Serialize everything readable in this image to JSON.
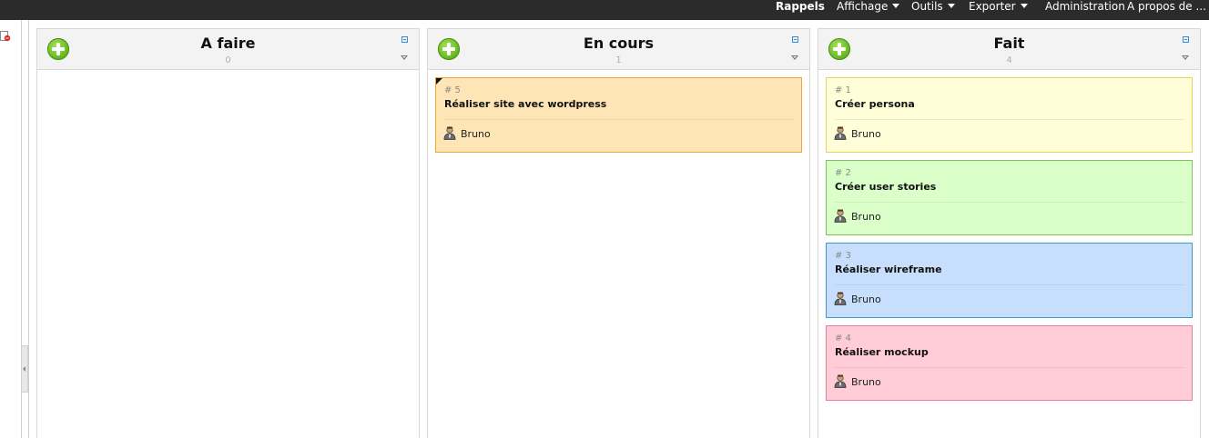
{
  "topbar": {
    "items": [
      {
        "label": "Rappels"
      },
      {
        "label": "Affichage"
      },
      {
        "label": "Outils"
      },
      {
        "label": "Exporter"
      },
      {
        "label": "Administration"
      },
      {
        "label": "A propos de ..."
      }
    ]
  },
  "columns": [
    {
      "title": "A faire",
      "count": "0",
      "cards": []
    },
    {
      "title": "En cours",
      "count": "1",
      "cards": [
        {
          "number": "# 5",
          "title": "Réaliser site avec wordpress",
          "owner": "Bruno",
          "bg": "#fde5b5",
          "border": "#e9a63c"
        }
      ]
    },
    {
      "title": "Fait",
      "count": "4",
      "cards": [
        {
          "number": "# 1",
          "title": "Créer persona",
          "owner": "Bruno",
          "bg": "#fffed8",
          "border": "#e4d65a"
        },
        {
          "number": "# 2",
          "title": "Créer user stories",
          "owner": "Bruno",
          "bg": "#daffc8",
          "border": "#7bc25a"
        },
        {
          "number": "# 3",
          "title": "Réaliser wireframe",
          "owner": "Bruno",
          "bg": "#c7dffd",
          "border": "#3f9ad0"
        },
        {
          "number": "# 4",
          "title": "Réaliser mockup",
          "owner": "Bruno",
          "bg": "#ffccd8",
          "border": "#e27f9a"
        }
      ]
    }
  ],
  "colors": {
    "topbar": "#2b2b2b",
    "add_button": "#6fbf26",
    "column_header": "#f3f3f3"
  },
  "icons": {
    "add": "plus-circle-icon",
    "expand": "expand-icon",
    "collapse": "collapse-arrow-icon",
    "user": "user-icon"
  }
}
